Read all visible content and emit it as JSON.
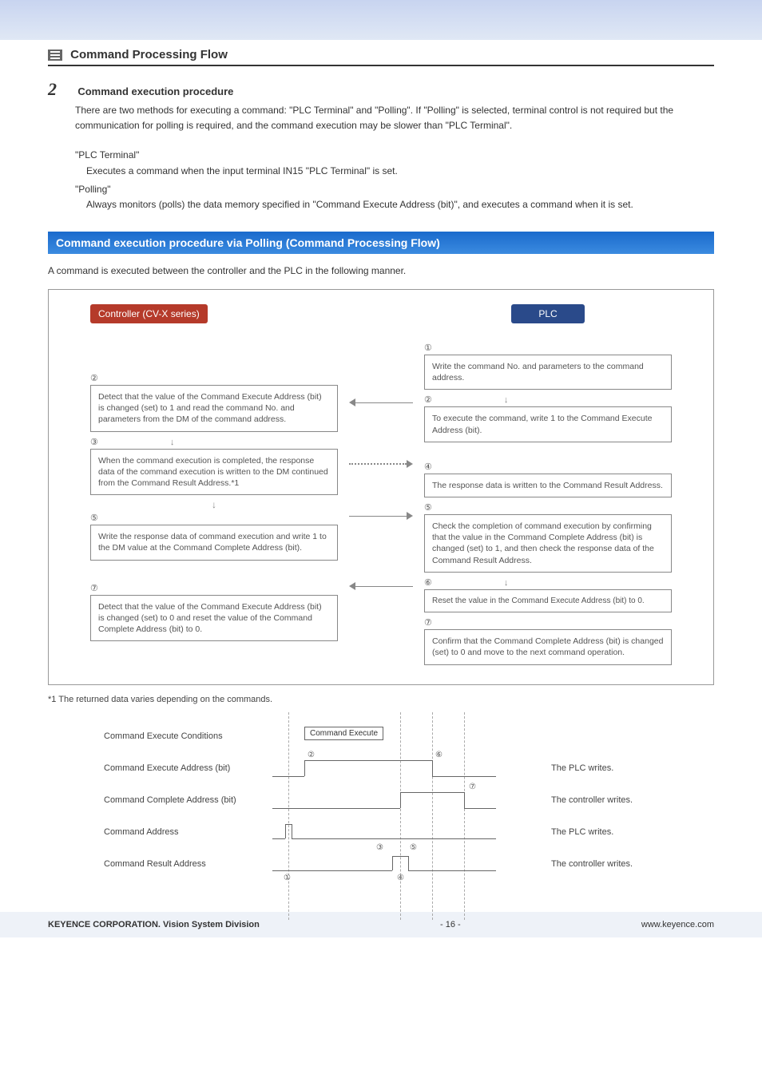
{
  "section_title": "Command Processing Flow",
  "step_number": "2",
  "step_title": "Command execution procedure",
  "intro": "There are two methods for executing a command: \"PLC Terminal\" and \"Polling\". If \"Polling\" is selected, terminal control is not required but the communication for polling is required, and the command execution may be slower than \"PLC Terminal\".",
  "mode1_title": "\"PLC Terminal\"",
  "mode1_desc": "Executes a command when the input terminal IN15 \"PLC Terminal\" is set.",
  "mode2_title": "\"Polling\"",
  "mode2_desc": "Always monitors (polls) the data memory specified in \"Command Execute Address (bit)\", and executes a command when it is set.",
  "blue_bar": "Command execution procedure via Polling (Command Processing Flow)",
  "blue_sub": "A command is executed between the controller and the PLC in the following manner.",
  "left_header": "Controller (CV-X series)",
  "right_header": "PLC",
  "left": {
    "n2": "②",
    "b2": "Detect that the value of the Command Execute Address (bit) is changed (set) to 1 and read the command No. and parameters from the DM of the command address.",
    "n3": "③",
    "b3": "When the command execution is completed, the response data of the command execution is written to the DM continued from the Command Result Address.*1",
    "n5": "⑤",
    "b5": "Write the response data of command execution and write 1 to the DM value at the Command Complete Address (bit).",
    "n7": "⑦",
    "b7": "Detect that the value of the Command Execute Address (bit) is changed (set) to 0 and reset the value of the Command Complete Address (bit) to 0."
  },
  "right": {
    "n1": "①",
    "b1": "Write the command No. and parameters to the command address.",
    "n2": "②",
    "b2": "To execute the command, write 1 to the Command Execute Address (bit).",
    "n4": "④",
    "b4": "The response data is written to the Command Result Address.",
    "n5": "⑤",
    "b5": "Check the completion of command execution by confirming that the value in the Command Complete Address (bit) is changed (set) to 1, and then check the response data of the Command Result Address.",
    "n6": "⑥",
    "b6": "Reset the value in the Command Execute Address (bit) to 0.",
    "n7": "⑦",
    "b7": "Confirm that the Command Complete Address (bit) is changed (set) to 0 and move to the next command operation."
  },
  "footnote": "*1 The returned data varies depending on the commands.",
  "timing": {
    "rows": [
      {
        "label": "Command Execute Conditions",
        "note": ""
      },
      {
        "label": "Command Execute Address (bit)",
        "note": "The PLC writes."
      },
      {
        "label": "Command Complete Address (bit)",
        "note": "The controller writes."
      },
      {
        "label": "Command Address",
        "note": "The PLC writes."
      },
      {
        "label": "Command Result Address",
        "note": "The controller writes."
      }
    ],
    "cmd_exec_box": "Command Execute",
    "marks": {
      "c1": "①",
      "c2": "②",
      "c3": "③",
      "c4": "④",
      "c5": "⑤",
      "c6": "⑥",
      "c7": "⑦"
    }
  },
  "footer": {
    "left": "KEYENCE CORPORATION. Vision System Division",
    "center": "- 16 -",
    "right": "www.keyence.com"
  }
}
